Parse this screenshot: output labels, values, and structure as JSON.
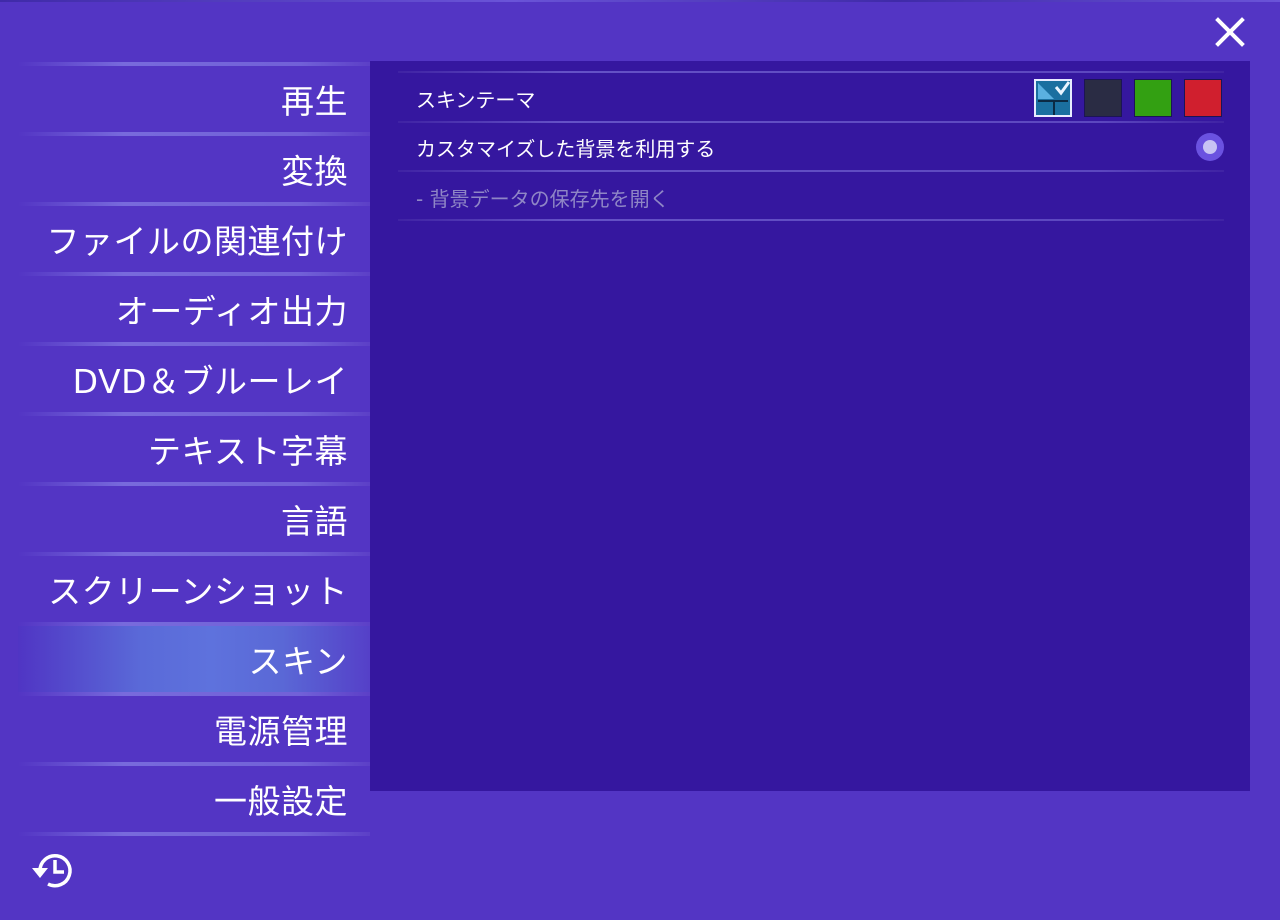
{
  "nav": {
    "items": [
      {
        "label": "再生"
      },
      {
        "label": "変換"
      },
      {
        "label": "ファイルの関連付け"
      },
      {
        "label": "オーディオ出力"
      },
      {
        "label": "DVD＆ブルーレイ"
      },
      {
        "label": "テキスト字幕"
      },
      {
        "label": "言語"
      },
      {
        "label": "スクリーンショット"
      },
      {
        "label": "スキン",
        "active": true
      },
      {
        "label": "電源管理"
      },
      {
        "label": "一般設定"
      }
    ]
  },
  "window": {
    "close_icon": "close-icon",
    "history_icon": "history-restore-icon"
  },
  "skin": {
    "theme_label": "スキンテーマ",
    "swatches": [
      {
        "name": "blue",
        "color": "#1a6fa0",
        "selected": true
      },
      {
        "name": "dark",
        "color": "#2a2c44",
        "selected": false
      },
      {
        "name": "green",
        "color": "#33a012",
        "selected": false
      },
      {
        "name": "red",
        "color": "#d01f2e",
        "selected": false
      }
    ],
    "custom_bg_label": "カスタマイズした背景を利用する",
    "custom_bg_enabled": false,
    "open_folder_label": "- 背景データの保存先を開く"
  },
  "colors": {
    "window_bg": "#5335c4",
    "panel_bg": "#35179f",
    "active_item": "#5e72dd",
    "disabled_text": "#8f86c6"
  }
}
